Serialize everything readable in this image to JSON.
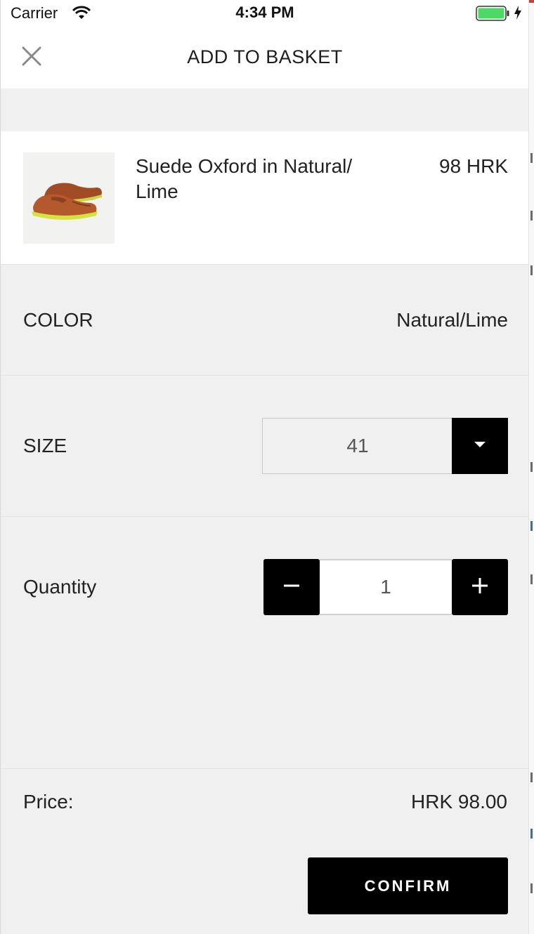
{
  "status_bar": {
    "carrier": "Carrier",
    "time": "4:34 PM",
    "wifi_icon": "wifi-icon",
    "battery_icon": "battery-icon",
    "battery_color": "#4cd964"
  },
  "header": {
    "title": "ADD TO BASKET",
    "close_icon": "close-icon"
  },
  "product": {
    "name": "Suede Oxford in Natural/ Lime",
    "price": "98 HRK",
    "image_icon": "shoe-image"
  },
  "color_row": {
    "label": "COLOR",
    "value": "Natural/Lime"
  },
  "size_row": {
    "label": "SIZE",
    "selected": "41",
    "dropdown_icon": "chevron-down-icon"
  },
  "quantity_row": {
    "label": "Quantity",
    "value": "1",
    "minus_icon": "minus-icon",
    "plus_icon": "plus-icon"
  },
  "footer": {
    "price_label": "Price:",
    "price_total": "HRK 98.00",
    "confirm_label": "CONFIRM"
  },
  "colors": {
    "accent": "#000000",
    "background": "#f0f0f0",
    "card": "#ffffff"
  }
}
